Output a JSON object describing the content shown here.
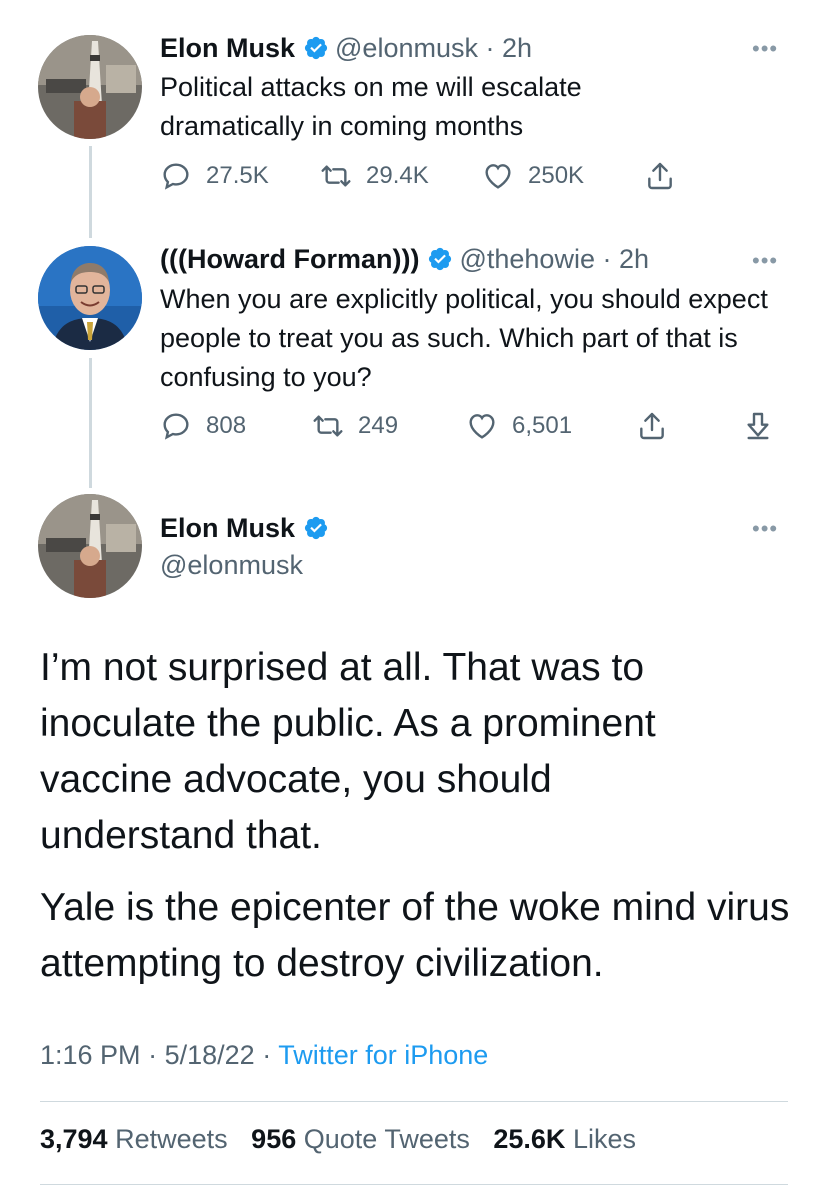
{
  "colors": {
    "accent": "#1d9bf0",
    "secondary_text": "#536471",
    "text": "#0f1419",
    "thread_line": "#cfd9de"
  },
  "tweet1": {
    "name": "Elon Musk",
    "handle": "@elonmusk",
    "time": "· 2h",
    "more": "•••",
    "text": "Political attacks on me will escalate dramatically in coming months",
    "replies": "27.5K",
    "retweets": "29.4K",
    "likes": "250K",
    "icons": [
      "reply-icon",
      "retweet-icon",
      "like-icon",
      "share-icon"
    ]
  },
  "tweet2": {
    "name": "(((Howard Forman)))",
    "handle": "@thehowie",
    "time": "· 2h",
    "more": "•••",
    "text": "When you are explicitly political, you should expect people to treat you as such. Which part of that is confusing to you?",
    "replies": "808",
    "retweets": "249",
    "likes": "6,501",
    "icons": [
      "reply-icon",
      "retweet-icon",
      "like-icon",
      "share-icon",
      "download-icon"
    ]
  },
  "main": {
    "name": "Elon Musk",
    "handle": "@elonmusk",
    "more": "•••",
    "paragraph1": "I’m not surprised at all. That was to inoculate the public. As a prominent vaccine advocate, you should understand that.",
    "paragraph2": "Yale is the epicenter of the woke mind virus attempting to destroy civilization.",
    "time": "1:16 PM",
    "date": "5/18/22",
    "separator": "·",
    "source": "Twitter for iPhone",
    "retweets_count": "3,794",
    "retweets_label": "Retweets",
    "quotes_count": "956",
    "quotes_label": "Quote Tweets",
    "likes_count": "25.6K",
    "likes_label": "Likes"
  }
}
